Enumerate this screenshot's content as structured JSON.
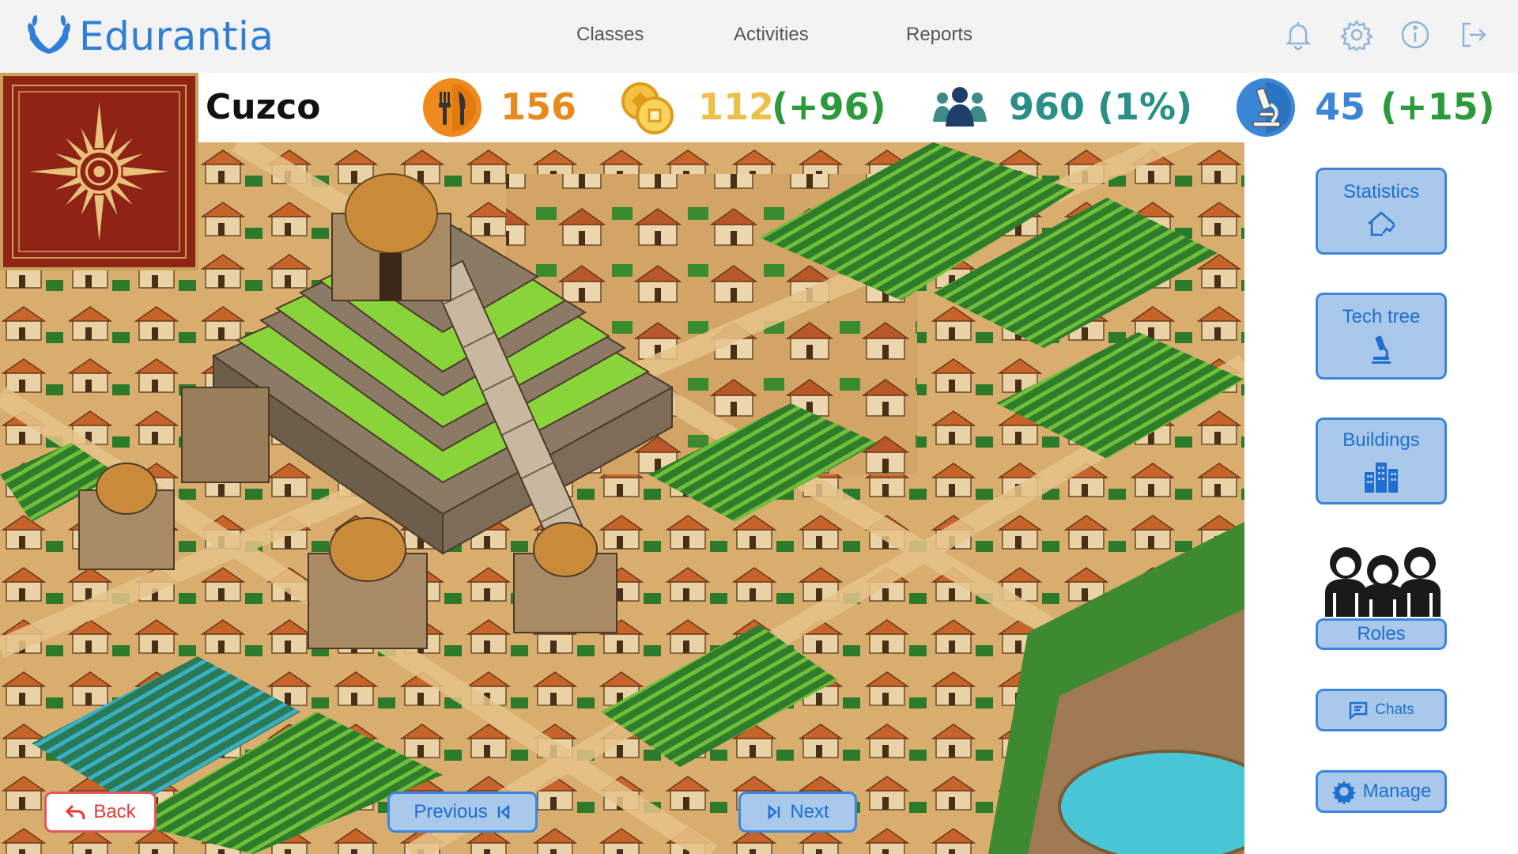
{
  "app": {
    "name": "Edurantia"
  },
  "nav": {
    "links": [
      "Classes",
      "Activities",
      "Reports"
    ],
    "icons": [
      "bell-icon",
      "gear-icon",
      "info-icon",
      "logout-icon"
    ]
  },
  "city": {
    "name": "Cuzco"
  },
  "stats": {
    "food": {
      "value": "156",
      "icon": "food-icon"
    },
    "gold": {
      "value": "112",
      "delta": "(+96)",
      "icon": "coins-icon"
    },
    "population": {
      "value": "960",
      "delta": "(1%)",
      "icon": "people-icon"
    },
    "science": {
      "value": "45",
      "delta": "(+15)",
      "icon": "microscope-icon"
    }
  },
  "side": {
    "statistics": "Statistics",
    "tech_tree": "Tech tree",
    "buildings": "Buildings",
    "roles": "Roles",
    "chats": "Chats",
    "manage": "Manage"
  },
  "bottom": {
    "back": "Back",
    "previous": "Previous",
    "next": "Next"
  },
  "colors": {
    "accent": "#2f7fd6",
    "button_fill": "#a9c8ea",
    "button_border": "#3a86dd",
    "back_border": "#e05a5a",
    "food": "#e8891e",
    "gold": "#ecc04a",
    "population": "#2a8f86",
    "science": "#3a87d6",
    "delta": "#2a9a3a",
    "emblem": "#8f2315"
  }
}
